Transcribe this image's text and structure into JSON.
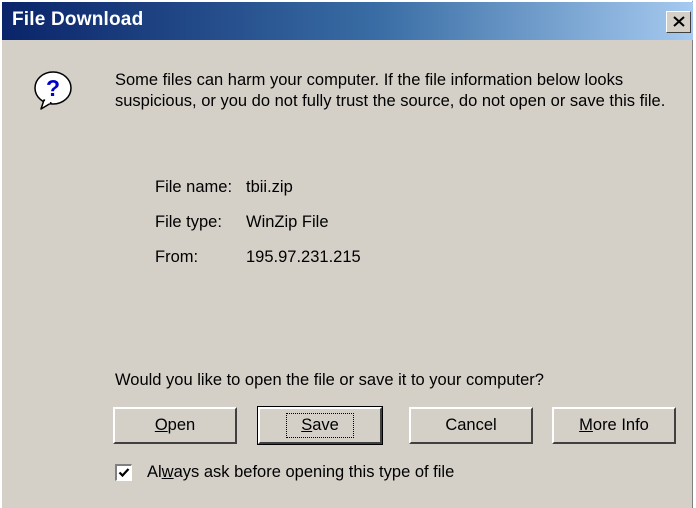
{
  "window": {
    "title": "File Download",
    "close_glyph": "×"
  },
  "icon": {
    "name": "question-icon",
    "glyph": "?"
  },
  "message": "Some files can harm your computer. If the file information below looks suspicious, or you do not fully trust the source, do not open or save this file.",
  "file_info": {
    "name_label": "File name:",
    "name_value": "tbii.zip",
    "type_label": "File type:",
    "type_value": "WinZip File",
    "from_label": "From:",
    "from_value": "195.97.231.215"
  },
  "question": "Would you like to open the file or save it to your computer?",
  "buttons": {
    "open": {
      "pre": "",
      "key": "O",
      "post": "pen"
    },
    "save": {
      "pre": "",
      "key": "S",
      "post": "ave"
    },
    "cancel": {
      "label": "Cancel"
    },
    "more_info": {
      "pre": "",
      "key": "M",
      "post": "ore Info"
    }
  },
  "checkbox": {
    "checked": true,
    "pre": "Al",
    "key": "w",
    "post": "ays ask before opening this type of file"
  }
}
